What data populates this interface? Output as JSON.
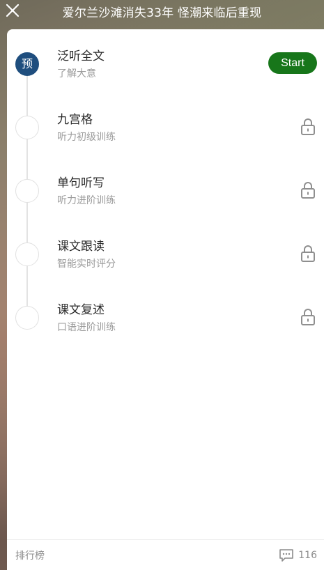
{
  "header": {
    "title": "爱尔兰沙滩消失33年 怪潮来临后重现",
    "close_icon": "close-icon"
  },
  "steps": [
    {
      "title": "泛听全文",
      "subtitle": "了解大意",
      "badge": "预",
      "action": "Start",
      "locked": false
    },
    {
      "title": "九宫格",
      "subtitle": "听力初级训练",
      "locked": true,
      "icon": "lock-icon"
    },
    {
      "title": "单句听写",
      "subtitle": "听力进阶训练",
      "locked": true,
      "icon": "lock-icon"
    },
    {
      "title": "课文跟读",
      "subtitle": "智能实时评分",
      "locked": true,
      "icon": "lock-icon"
    },
    {
      "title": "课文复述",
      "subtitle": "口语进阶训练",
      "locked": true,
      "icon": "lock-icon"
    }
  ],
  "footer": {
    "leaderboard_label": "排行榜",
    "comment_icon": "comment-icon",
    "comment_count": "116"
  },
  "colors": {
    "start_button": "#17761a",
    "active_node": "#1f4e7e"
  }
}
